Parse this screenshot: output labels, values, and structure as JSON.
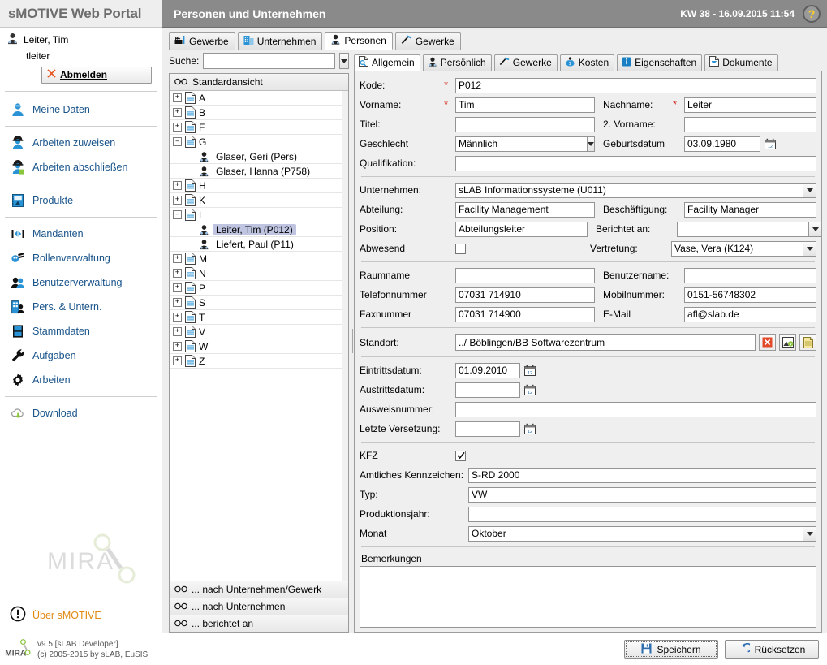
{
  "header": {
    "brand": "sMOTIVE Web Portal",
    "title": "Personen und Unternehmen",
    "datetime": "KW 38 - 16.09.2015 11:54",
    "help_icon": "?"
  },
  "sidebar": {
    "user_name": "Leiter, Tim",
    "user_login": "tleiter",
    "logout_label": "Abmelden",
    "nav": [
      {
        "label": "Meine Daten",
        "icon": "user-icon"
      },
      {
        "label": "Arbeiten zuweisen",
        "icon": "worker-assign-icon"
      },
      {
        "label": "Arbeiten abschließen",
        "icon": "worker-complete-icon"
      },
      {
        "label": "Produkte",
        "icon": "product-icon"
      },
      {
        "label": "Mandanten",
        "icon": "clients-icon"
      },
      {
        "label": "Rollenverwaltung",
        "icon": "roles-icon"
      },
      {
        "label": "Benutzerverwaltung",
        "icon": "users-icon"
      },
      {
        "label": "Pers. & Untern.",
        "icon": "persons-companies-icon"
      },
      {
        "label": "Stammdaten",
        "icon": "masterdata-icon"
      },
      {
        "label": "Aufgaben",
        "icon": "wrench-icon"
      },
      {
        "label": "Arbeiten",
        "icon": "gear-icon"
      },
      {
        "label": "Download",
        "icon": "cloud-download-icon"
      }
    ],
    "watermark": "MIRA",
    "about_label": "Über sMOTIVE",
    "footer_line1": "v9.5 [sLAB Developer]",
    "footer_line2": "(c) 2005-2015 by sLAB, EuSIS"
  },
  "main_tabs": [
    {
      "label": "Gewerbe",
      "icon": "factory-icon",
      "active": false
    },
    {
      "label": "Unternehmen",
      "icon": "building-icon",
      "active": false
    },
    {
      "label": "Personen",
      "icon": "person-icon",
      "active": true
    },
    {
      "label": "Gewerke",
      "icon": "hammer-icon",
      "active": false
    }
  ],
  "tree_panel": {
    "search_label": "Suche:",
    "search_value": "",
    "view_title": "Standardansicht",
    "nodes": [
      {
        "label": "A",
        "type": "group",
        "expanded": false
      },
      {
        "label": "B",
        "type": "group",
        "expanded": false
      },
      {
        "label": "F",
        "type": "group",
        "expanded": false
      },
      {
        "label": "G",
        "type": "group",
        "expanded": true
      },
      {
        "label": "Glaser, Geri (Pers)",
        "type": "person",
        "selected": false
      },
      {
        "label": "Glaser, Hanna (P758)",
        "type": "person",
        "selected": false
      },
      {
        "label": "H",
        "type": "group",
        "expanded": false
      },
      {
        "label": "K",
        "type": "group",
        "expanded": false
      },
      {
        "label": "L",
        "type": "group",
        "expanded": true
      },
      {
        "label": "Leiter, Tim (P012)",
        "type": "person",
        "selected": true
      },
      {
        "label": "Liefert, Paul (P11)",
        "type": "person",
        "selected": false
      },
      {
        "label": "M",
        "type": "group",
        "expanded": false
      },
      {
        "label": "N",
        "type": "group",
        "expanded": false
      },
      {
        "label": "P",
        "type": "group",
        "expanded": false
      },
      {
        "label": "S",
        "type": "group",
        "expanded": false
      },
      {
        "label": "T",
        "type": "group",
        "expanded": false
      },
      {
        "label": "V",
        "type": "group",
        "expanded": false
      },
      {
        "label": "W",
        "type": "group",
        "expanded": false
      },
      {
        "label": "Z",
        "type": "group",
        "expanded": false
      }
    ],
    "footer_views": [
      "... nach Unternehmen/Gewerk",
      "... nach Unternehmen",
      "... berichtet an"
    ]
  },
  "form": {
    "tabs": [
      {
        "label": "Allgemein",
        "icon": "document-search-icon",
        "active": true
      },
      {
        "label": "Persönlich",
        "icon": "person-icon",
        "active": false
      },
      {
        "label": "Gewerke",
        "icon": "hammer-icon",
        "active": false
      },
      {
        "label": "Kosten",
        "icon": "money-icon",
        "active": false
      },
      {
        "label": "Eigenschaften",
        "icon": "info-icon",
        "active": false
      },
      {
        "label": "Dokumente",
        "icon": "documents-icon",
        "active": false
      }
    ],
    "fields": {
      "kode_label": "Kode:",
      "kode_value": "P012",
      "vorname_label": "Vorname:",
      "vorname_value": "Tim",
      "nachname_label": "Nachname:",
      "nachname_value": "Leiter",
      "titel_label": "Titel:",
      "titel_value": "",
      "zweitvorname_label": "2. Vorname:",
      "zweitvorname_value": "",
      "geschlecht_label": "Geschlecht",
      "geschlecht_value": "Männlich",
      "geburtsdatum_label": "Geburtsdatum",
      "geburtsdatum_value": "03.09.1980",
      "qualifikation_label": "Qualifikation:",
      "qualifikation_value": "",
      "unternehmen_label": "Unternehmen:",
      "unternehmen_value": "sLAB Informationssysteme (U011)",
      "abteilung_label": "Abteilung:",
      "abteilung_value": "Facility Management",
      "beschaeftigung_label": "Beschäftigung:",
      "beschaeftigung_value": "Facility Manager",
      "position_label": "Position:",
      "position_value": "Abteilungsleiter",
      "berichtet_an_label": "Berichtet an:",
      "berichtet_an_value": "",
      "abwesend_label": "Abwesend",
      "abwesend_checked": false,
      "vertretung_label": "Vertretung:",
      "vertretung_value": "Vase, Vera (K124)",
      "raumname_label": "Raumname",
      "raumname_value": "",
      "benutzername_label": "Benutzername:",
      "benutzername_value": "",
      "telefonnummer_label": "Telefonnummer",
      "telefonnummer_value": "07031 714910",
      "mobilnummer_label": "Mobilnummer:",
      "mobilnummer_value": "0151-56748302",
      "faxnummer_label": "Faxnummer",
      "faxnummer_value": "07031 714900",
      "email_label": "E-Mail",
      "email_value": "afl@slab.de",
      "standort_label": "Standort:",
      "standort_value": "../ Böblingen/BB Softwarezentrum",
      "eintrittsdatum_label": "Eintrittsdatum:",
      "eintrittsdatum_value": "01.09.2010",
      "austrittsdatum_label": "Austrittsdatum:",
      "austrittsdatum_value": "",
      "ausweisnummer_label": "Ausweisnummer:",
      "ausweisnummer_value": "",
      "letzte_versetzung_label": "Letzte Versetzung:",
      "letzte_versetzung_value": "",
      "kfz_label": "KFZ",
      "kfz_checked": true,
      "kennzeichen_label": "Amtliches Kennzeichen:",
      "kennzeichen_value": "S-RD 2000",
      "typ_label": "Typ:",
      "typ_value": "VW",
      "produktionsjahr_label": "Produktionsjahr:",
      "produktionsjahr_value": "",
      "monat_label": "Monat",
      "monat_value": "Oktober",
      "bemerkungen_label": "Bemerkungen",
      "bemerkungen_value": ""
    },
    "standort_buttons": [
      {
        "name": "clear-location-button",
        "icon": "red-x-icon"
      },
      {
        "name": "pick-location-button",
        "icon": "refresh-location-icon"
      },
      {
        "name": "open-location-button",
        "icon": "note-icon"
      }
    ]
  },
  "footer_buttons": {
    "save_label": "Speichern",
    "reset_label": "Rücksetzen"
  },
  "colors": {
    "titlebar": "#8a8a8a",
    "brand_text": "#6d6d6d",
    "link": "#18538a",
    "accent_orange": "#e08a14",
    "required_red": "#d62d20",
    "selection": "#bfc4e0",
    "help_yellow": "#ffd21e"
  }
}
